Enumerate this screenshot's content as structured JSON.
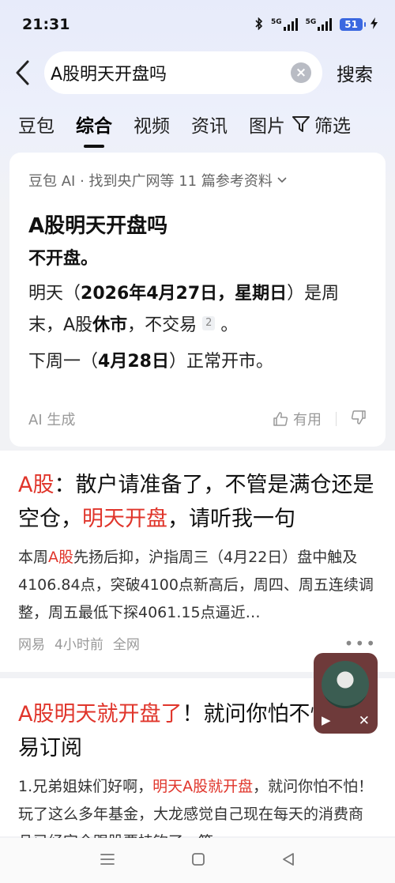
{
  "status_bar": {
    "time": "21:31",
    "network1": "5G",
    "network2": "5G",
    "battery": "51"
  },
  "search": {
    "query": "A股明天开盘吗",
    "button": "搜索"
  },
  "tabs": [
    {
      "label": "豆包",
      "active": false
    },
    {
      "label": "综合",
      "active": true
    },
    {
      "label": "视频",
      "active": false
    },
    {
      "label": "资讯",
      "active": false
    },
    {
      "label": "图片",
      "active": false
    }
  ],
  "filter_label": "筛选",
  "ai_card": {
    "source": "豆包 AI · 找到央广网等 11 篇参考资料",
    "title": "A股明天开盘吗",
    "answer": "不开盘。",
    "p1_a": "明天（",
    "p1_b": "2026年4月27日，星期日",
    "p1_c": "）是周末，A股",
    "p1_d": "休市",
    "p1_e": "，不交易",
    "p1_cite": "2",
    "p1_f": "。",
    "p2_a": "下周一（",
    "p2_b": "4月28日",
    "p2_c": "）正常开市。",
    "footer_gen": "AI 生成",
    "useful": "有用"
  },
  "results": [
    {
      "title_parts": [
        "A股",
        "：散户请准备了，不管是满仓还是空仓，",
        "明天开盘",
        "，请听我一句"
      ],
      "snippet_a": "本周",
      "snippet_hl": "A股",
      "snippet_b": "先扬后抑，沪指周三（4月22日）盘中触及4106.84点，突破4100点新高后，周四、周五连续调整，周五最低下探4061.15点逼近…",
      "source": "网易",
      "time": "4小时前",
      "scope": "全网"
    },
    {
      "title_parts": [
        "A股明天就开盘了",
        "！就问你怕不怕！网易订阅"
      ],
      "snippet_a": "1.兄弟姐妹们好啊，",
      "snippet_hl": "明天A股就开盘",
      "snippet_b": "，就问你怕不怕！玩了这么多年基金，大龙感觉自己现在每天的消费商品已经完全跟股票挂钩了，等"
    }
  ],
  "colors": {
    "highlight": "#e0352b",
    "accent": "#3b68e0"
  }
}
